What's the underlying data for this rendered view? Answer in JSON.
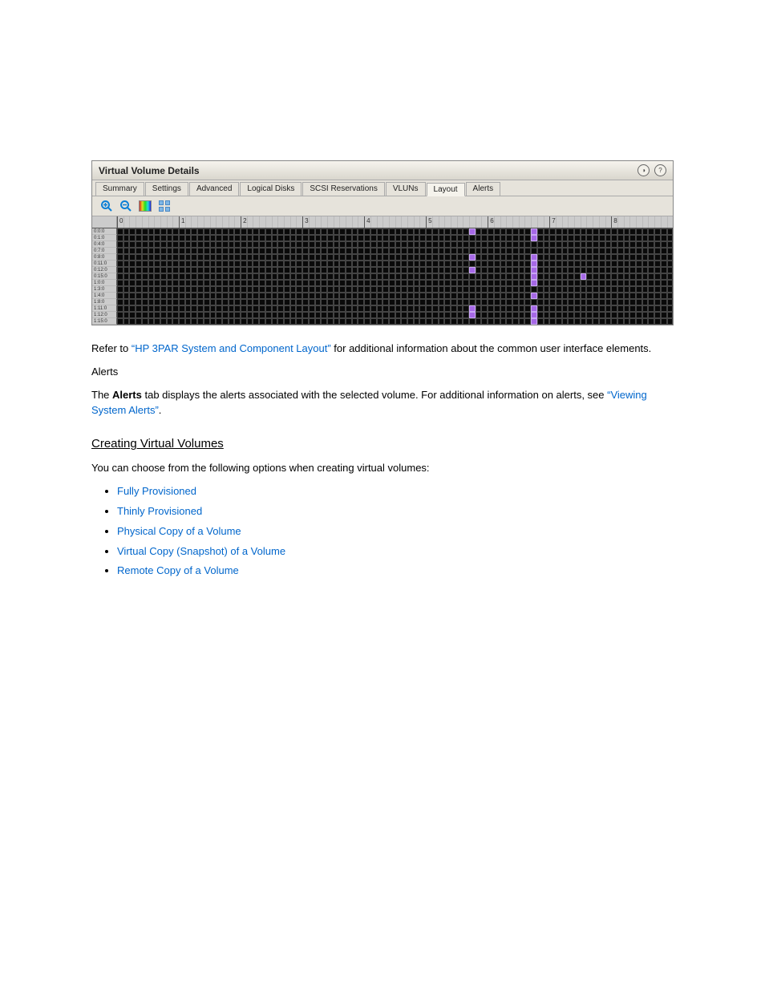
{
  "panel": {
    "title": "Virtual Volume Details",
    "tabs": [
      "Summary",
      "Settings",
      "Advanced",
      "Logical Disks",
      "SCSI Reservations",
      "VLUNs",
      "Layout",
      "Alerts"
    ],
    "activeTab": 6,
    "toolbar": {
      "zoomIn": "zoom-in",
      "zoomOut": "zoom-out",
      "legend": "legend",
      "expand": "expand"
    },
    "grid": {
      "colMajors": [
        0,
        1,
        2,
        3,
        4,
        5,
        6,
        7,
        8
      ],
      "ticksPerMajor": 10,
      "rows": [
        "0:0:0",
        "0:1:0",
        "0:4:0",
        "0:7:0",
        "0:8:0",
        "0:11:0",
        "0:12:0",
        "0:15:0",
        "1:0:0",
        "1:3:0",
        "1:4:0",
        "1:8:0",
        "1:11:0",
        "1:12:0",
        "1:15:0"
      ],
      "highlights": [
        {
          "row": 0,
          "col": 57
        },
        {
          "row": 0,
          "col": 67
        },
        {
          "row": 1,
          "col": 67
        },
        {
          "row": 4,
          "col": 57
        },
        {
          "row": 4,
          "col": 67
        },
        {
          "row": 5,
          "col": 67
        },
        {
          "row": 6,
          "col": 57
        },
        {
          "row": 6,
          "col": 67
        },
        {
          "row": 7,
          "col": 67
        },
        {
          "row": 7,
          "col": 75
        },
        {
          "row": 8,
          "col": 67
        },
        {
          "row": 10,
          "col": 67
        },
        {
          "row": 12,
          "col": 57
        },
        {
          "row": 12,
          "col": 67
        },
        {
          "row": 13,
          "col": 57
        },
        {
          "row": 13,
          "col": 67
        },
        {
          "row": 14,
          "col": 67
        }
      ]
    }
  },
  "doc": {
    "para1_pre": "Refer to ",
    "para1_link": "“HP 3PAR System and Component Layout”",
    "para1_post": " for additional information about the common user interface elements.",
    "section1_title": "Alerts",
    "para2_pre": "The ",
    "para2_b": "Alerts",
    "para2_mid": " tab displays the alerts associated with the selected volume. For additional information on alerts, see ",
    "para2_link": "“Viewing System Alerts”",
    "para2_end": ".",
    "h2": "Creating Virtual Volumes",
    "para3": "You can choose from the following options when creating virtual volumes:",
    "list": [
      "Fully Provisioned",
      "Thinly Provisioned",
      "Physical Copy of a Volume",
      "Virtual Copy (Snapshot) of a Volume",
      "Remote Copy of a Volume"
    ]
  }
}
